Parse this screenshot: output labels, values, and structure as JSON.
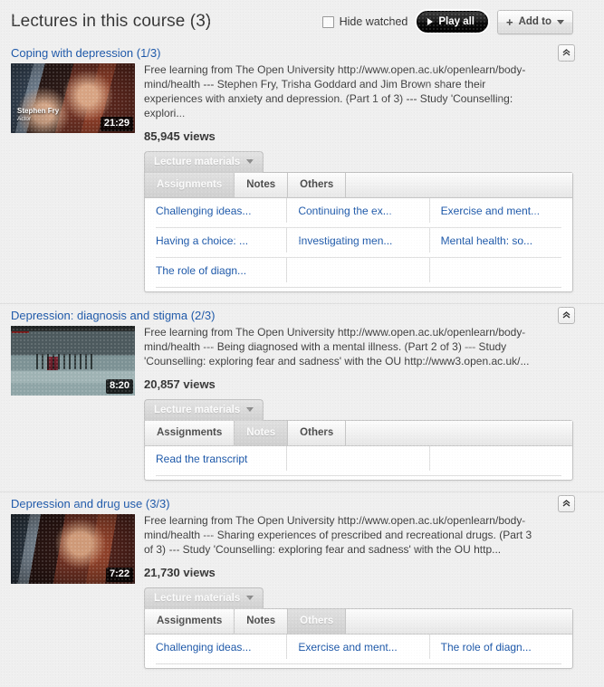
{
  "header": {
    "title": "Lectures in this course (3)",
    "hide_watched_label": "Hide watched",
    "hide_watched_checked": false,
    "play_all_label": "Play all",
    "add_to_label": "Add to",
    "add_to_plus": "+"
  },
  "materials_toggle_label": "Lecture materials",
  "tab_labels": [
    "Assignments",
    "Notes",
    "Others"
  ],
  "colors": {
    "link": "#1a56a8",
    "page_background": "#efefef",
    "panel_background": "#ffffff",
    "play_all_background": "#000000"
  },
  "lectures": [
    {
      "title": "Coping with depression (1/3)",
      "description": "Free learning from The Open University http://www.open.ac.uk/openlearn/body-mind/health --- Stephen Fry, Trisha Goddard and Jim Brown share their experiences with anxiety and depression. (Part 1 of 3) --- Study 'Counselling: explori...",
      "views": "85,945 views",
      "duration": "21:29",
      "thumb_caption": "Stephen Fry",
      "thumb_caption_sub": "Actor",
      "active_tab": 0,
      "materials": [
        [
          "Challenging ideas...",
          "Continuing the ex...",
          "Exercise and ment..."
        ],
        [
          "Having a choice: ...",
          "Investigating men...",
          "Mental health: so..."
        ],
        [
          "The role of diagn...",
          "",
          ""
        ]
      ]
    },
    {
      "title": "Depression: diagnosis and stigma (2/3)",
      "description": "Free learning from The Open University http://www.open.ac.uk/openlearn/body-mind/health --- Being diagnosed with a mental illness. (Part 2 of 3) --- Study 'Counselling: exploring fear and sadness' with the OU http://www3.open.ac.uk/...",
      "views": "20,857 views",
      "duration": "8:20",
      "thumb_caption": "",
      "thumb_caption_sub": "",
      "active_tab": 1,
      "materials": [
        [
          "Read the transcript",
          "",
          ""
        ]
      ]
    },
    {
      "title": "Depression and drug use (3/3)",
      "description": "Free learning from The Open University http://www.open.ac.uk/openlearn/body-mind/health --- Sharing experiences of prescribed and recreational drugs. (Part 3 of 3) --- Study 'Counselling: exploring fear and sadness' with the OU http...",
      "views": "21,730 views",
      "duration": "7:22",
      "thumb_caption": "",
      "thumb_caption_sub": "",
      "active_tab": 2,
      "materials": [
        [
          "Challenging ideas...",
          "Exercise and ment...",
          "The role of diagn..."
        ]
      ]
    }
  ]
}
